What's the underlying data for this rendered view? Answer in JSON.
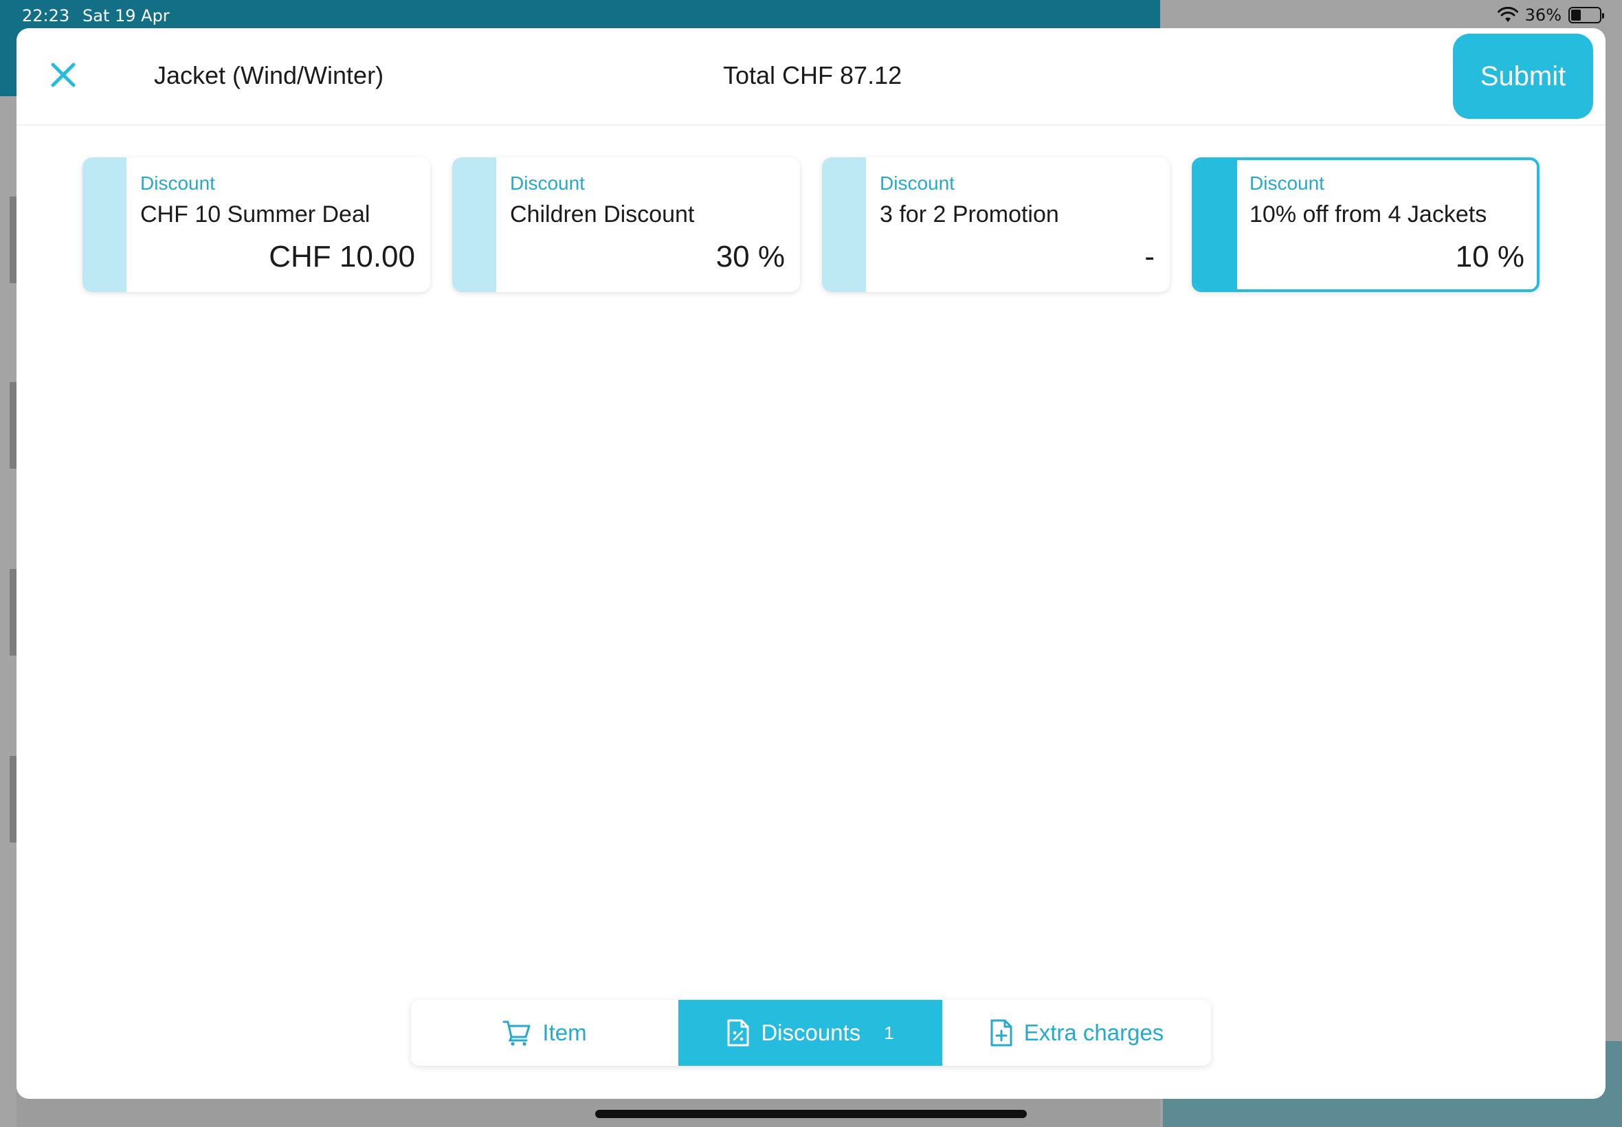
{
  "status_bar": {
    "time": "22:23",
    "date": "Sat 19 Apr",
    "battery": "36%",
    "battery_level": 0.36
  },
  "header": {
    "item_title": "Jacket (Wind/Winter)",
    "total": "Total CHF 87.12",
    "submit_label": "Submit"
  },
  "discounts": [
    {
      "type": "Discount",
      "name": "CHF 10 Summer Deal",
      "value": "CHF 10.00",
      "selected": false
    },
    {
      "type": "Discount",
      "name": "Children Discount",
      "value": "30 %",
      "selected": false
    },
    {
      "type": "Discount",
      "name": "3 for 2 Promotion",
      "value": "-",
      "selected": false
    },
    {
      "type": "Discount",
      "name": "10% off from 4 Jackets",
      "value": "10 %",
      "selected": true
    }
  ],
  "tabs": {
    "item": {
      "label": "Item",
      "icon": "cart-icon"
    },
    "discounts": {
      "label": "Discounts",
      "badge": "1",
      "icon": "percent-document-icon",
      "active": true
    },
    "extra": {
      "label": "Extra charges",
      "icon": "add-document-icon"
    }
  },
  "colors": {
    "accent": "#25bcde",
    "accent_text": "#25a9cc",
    "stripe_light": "#bde9f5",
    "header_bg": "#136f86"
  }
}
